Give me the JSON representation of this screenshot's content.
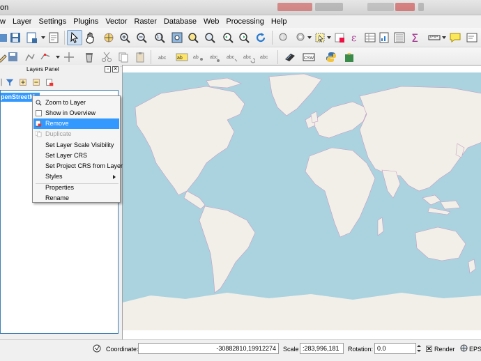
{
  "window": {
    "title_fragment": "on"
  },
  "menubar": {
    "items": [
      "w",
      "Layer",
      "Settings",
      "Plugins",
      "Vector",
      "Raster",
      "Database",
      "Web",
      "Processing",
      "Help"
    ]
  },
  "layers_panel": {
    "title": "Layers Panel",
    "layer_name": "penStreetM"
  },
  "context_menu": {
    "items": [
      {
        "label": "Zoom to Layer",
        "icon": "zoom-to-layer-icon"
      },
      {
        "label": "Show in Overview",
        "icon": "checkbox-icon"
      },
      {
        "label": "Remove",
        "icon": "remove-icon",
        "highlighted": true
      },
      {
        "label": "Duplicate",
        "icon": "duplicate-icon",
        "disabled": true
      },
      {
        "label": "Set Layer Scale Visibility"
      },
      {
        "label": "Set Layer CRS"
      },
      {
        "label": "Set Project CRS from Layer"
      },
      {
        "label": "Styles",
        "submenu": true
      },
      {
        "label": "Properties"
      },
      {
        "label": "Rename"
      }
    ]
  },
  "status": {
    "coordinate_label": "Coordinate:",
    "coordinate_value": "-30882810,19912274",
    "scale_label": "Scale",
    "scale_value": ":283,996,181",
    "rotation_label": "Rotation:",
    "rotation_value": "0.0",
    "render_label": "Render",
    "render_checked": true,
    "crs_label": "EPSG"
  },
  "colors": {
    "ocean": "#aad3df",
    "land": "#f2efe9",
    "borders": "#c79cc3",
    "selection": "#3399ff"
  }
}
